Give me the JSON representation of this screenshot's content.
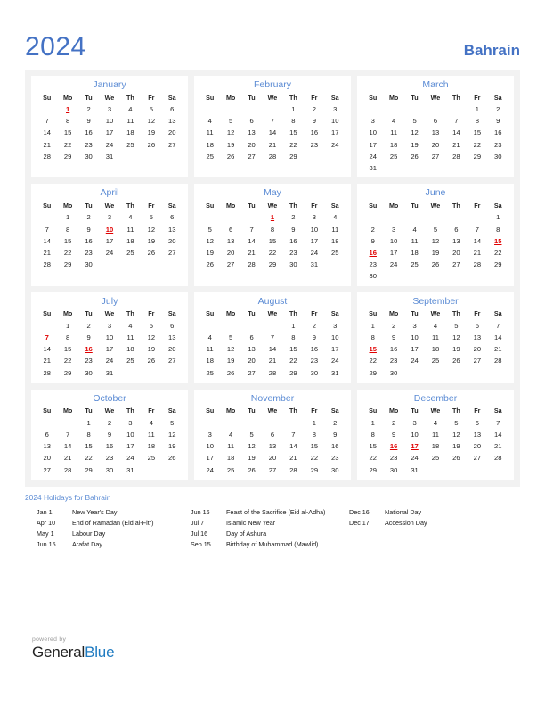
{
  "header": {
    "year": "2024",
    "country": "Bahrain"
  },
  "weekdays": [
    "Su",
    "Mo",
    "Tu",
    "We",
    "Th",
    "Fr",
    "Sa"
  ],
  "colors": {
    "accent_blue": "#4472c4",
    "month_blue": "#5b8bd4",
    "holiday_red": "#e00000",
    "panel_gray": "#f2f2f2",
    "brand_blue": "#1f7bc1"
  },
  "months": [
    {
      "name": "January",
      "lead_blanks": 1,
      "days": 31,
      "holidays": [
        1
      ]
    },
    {
      "name": "February",
      "lead_blanks": 4,
      "days": 29,
      "holidays": []
    },
    {
      "name": "March",
      "lead_blanks": 5,
      "days": 31,
      "holidays": []
    },
    {
      "name": "April",
      "lead_blanks": 1,
      "days": 30,
      "holidays": [
        10
      ]
    },
    {
      "name": "May",
      "lead_blanks": 3,
      "days": 31,
      "holidays": [
        1
      ]
    },
    {
      "name": "June",
      "lead_blanks": 6,
      "days": 30,
      "holidays": [
        15,
        16
      ]
    },
    {
      "name": "July",
      "lead_blanks": 1,
      "days": 31,
      "holidays": [
        7,
        16
      ]
    },
    {
      "name": "August",
      "lead_blanks": 4,
      "days": 31,
      "holidays": []
    },
    {
      "name": "September",
      "lead_blanks": 0,
      "days": 30,
      "holidays": [
        15
      ]
    },
    {
      "name": "October",
      "lead_blanks": 2,
      "days": 31,
      "holidays": []
    },
    {
      "name": "November",
      "lead_blanks": 5,
      "days": 30,
      "holidays": []
    },
    {
      "name": "December",
      "lead_blanks": 0,
      "days": 31,
      "holidays": [
        16,
        17
      ]
    }
  ],
  "holidays_section": {
    "heading": "2024 Holidays for Bahrain",
    "columns": [
      [
        {
          "date": "Jan 1",
          "name": "New Year's Day"
        },
        {
          "date": "Apr 10",
          "name": "End of Ramadan (Eid al-Fitr)"
        },
        {
          "date": "May 1",
          "name": "Labour Day"
        },
        {
          "date": "Jun 15",
          "name": "Arafat Day"
        }
      ],
      [
        {
          "date": "Jun 16",
          "name": "Feast of the Sacrifice (Eid al-Adha)"
        },
        {
          "date": "Jul 7",
          "name": "Islamic New Year"
        },
        {
          "date": "Jul 16",
          "name": "Day of Ashura"
        },
        {
          "date": "Sep 15",
          "name": "Birthday of Muhammad (Mawlid)"
        }
      ],
      [
        {
          "date": "Dec 16",
          "name": "National Day"
        },
        {
          "date": "Dec 17",
          "name": "Accession Day"
        }
      ]
    ]
  },
  "footer": {
    "powered_by": "powered by",
    "brand_first": "General",
    "brand_second": "Blue"
  }
}
